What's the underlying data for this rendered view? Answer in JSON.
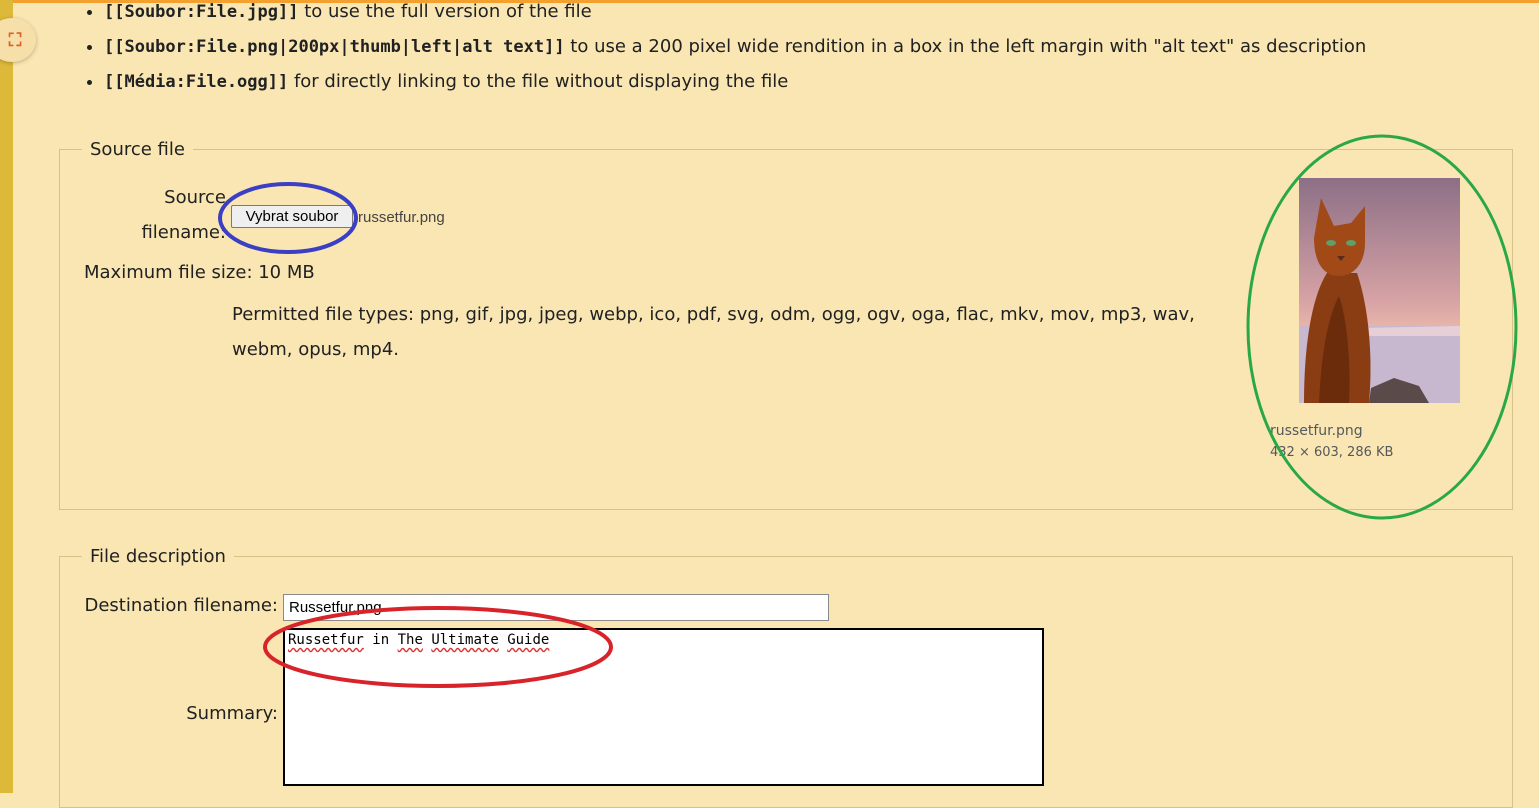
{
  "usage_list": [
    {
      "code": "[[Soubor:File.jpg]]",
      "text": " to use the full version of the file"
    },
    {
      "code": "[[Soubor:File.png|200px|thumb|left|alt text]]",
      "text": " to use a 200 pixel wide rendition in a box in the left margin with \"alt text\" as description"
    },
    {
      "code": "[[Média:File.ogg]]",
      "text": " for directly linking to the file without displaying the file"
    }
  ],
  "expand_icon": "expand-icon",
  "source_section": {
    "legend": "Source file",
    "label_line1": "Source",
    "label_line2": "filename:",
    "file_button": "Vybrat soubor",
    "file_name": "russetfur.png",
    "max_size": "Maximum file size: 10 MB",
    "permitted": "Permitted file types: png, gif, jpg, jpeg, webp, ico, pdf, svg, odm, ogg, ogv, oga, flac, mkv, mov, mp3, wav, webm, opus, mp4.",
    "thumb_name": "russetfur.png",
    "thumb_info": "432 × 603, 286 KB"
  },
  "description_section": {
    "legend": "File description",
    "dest_label": "Destination filename:",
    "dest_value": "Russetfur.png",
    "summary_label": "Summary:",
    "summary_words": [
      "Russetfur",
      "in",
      "The",
      "Ultimate",
      "Guide"
    ]
  },
  "annotation_colors": {
    "blue": "#3a3fc4",
    "green": "#2aa847",
    "red": "#d8232a"
  }
}
